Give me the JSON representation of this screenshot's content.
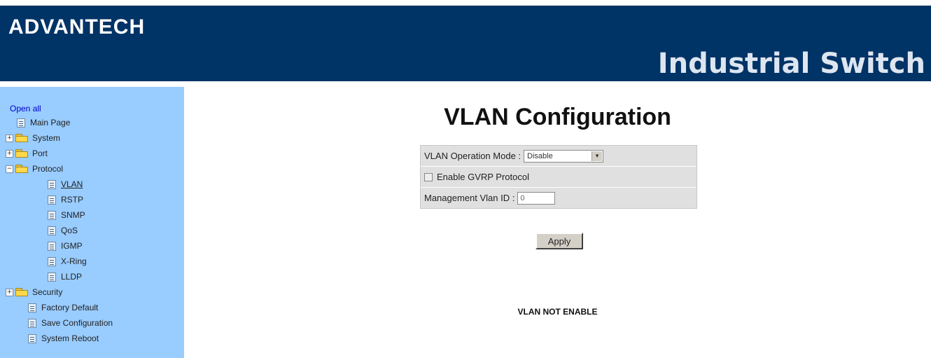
{
  "header": {
    "brand": "ADVANTECH",
    "product": "Industrial Switch",
    "bg_color": "#003366"
  },
  "sidebar": {
    "bg_color": "#99ccff",
    "open_all": "Open all",
    "items": [
      {
        "label": "Main Page",
        "icon": "page-icon"
      },
      {
        "label": "System",
        "icon": "folder-icon",
        "expander": "+"
      },
      {
        "label": "Port",
        "icon": "folder-icon",
        "expander": "+"
      },
      {
        "label": "Protocol",
        "icon": "folder-open-icon",
        "expander": "−"
      },
      {
        "label": "VLAN",
        "icon": "page-icon",
        "active": true
      },
      {
        "label": "RSTP",
        "icon": "page-icon"
      },
      {
        "label": "SNMP",
        "icon": "page-icon"
      },
      {
        "label": "QoS",
        "icon": "page-icon"
      },
      {
        "label": "IGMP",
        "icon": "page-icon"
      },
      {
        "label": "X-Ring",
        "icon": "page-icon"
      },
      {
        "label": "LLDP",
        "icon": "page-icon"
      },
      {
        "label": "Security",
        "icon": "folder-icon",
        "expander": "+"
      },
      {
        "label": "Factory Default",
        "icon": "page-icon"
      },
      {
        "label": "Save Configuration",
        "icon": "page-icon"
      },
      {
        "label": "System Reboot",
        "icon": "page-icon"
      }
    ]
  },
  "main": {
    "title": "VLAN Configuration",
    "form": {
      "mode_label": "VLAN Operation Mode :",
      "mode_value": "Disable",
      "gvrp_label": "Enable GVRP Protocol",
      "gvrp_checked": false,
      "mgmt_label": "Management Vlan ID :",
      "mgmt_value": "0"
    },
    "apply_label": "Apply",
    "status_text": "VLAN NOT ENABLE"
  }
}
